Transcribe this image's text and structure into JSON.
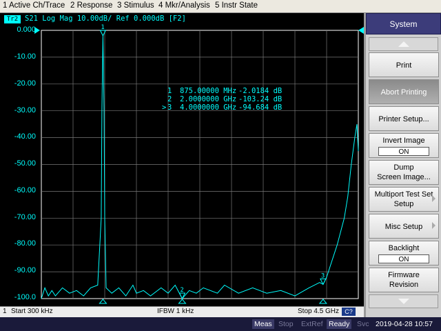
{
  "menu": [
    "1 Active Ch/Trace",
    "2 Response",
    "3 Stimulus",
    "4 Mkr/Analysis",
    "5 Instr State"
  ],
  "trace": {
    "badge": "Tr2",
    "info": "S21 Log Mag 10.00dB/ Ref 0.000dB [F2]",
    "color": "#00ffff"
  },
  "y_axis_labels": [
    "0.000",
    "-10.00",
    "-20.00",
    "-30.00",
    "-40.00",
    "-50.00",
    "-60.00",
    "-70.00",
    "-80.00",
    "-90.00",
    "-100.0"
  ],
  "markers": [
    {
      "label": "1",
      "prefix": "",
      "freq": "875.00000 MHz",
      "value": "-2.0184 dB"
    },
    {
      "label": "2",
      "prefix": "",
      "freq": "2.0000000 GHz",
      "value": "-103.24 dB"
    },
    {
      "label": "3",
      "prefix": ">",
      "freq": "4.0000000 GHz",
      "value": "-94.684 dB"
    }
  ],
  "footer": {
    "channel": "1",
    "start": "Start 300 kHz",
    "ifbw": "IFBW 1 kHz",
    "stop": "Stop 4.5 GHz",
    "cbadge": "C?"
  },
  "softkeys": {
    "title": "System",
    "items": [
      {
        "label": "Print"
      },
      {
        "label": "Abort Printing",
        "active": true
      },
      {
        "label": "Printer Setup..."
      },
      {
        "label": "Invert Image",
        "toggle": "ON"
      },
      {
        "label": "Dump",
        "label2": "Screen Image..."
      },
      {
        "label": "Multiport Test Set",
        "label2": "Setup",
        "chevron": true
      },
      {
        "label": "Misc Setup",
        "chevron": true
      },
      {
        "label": "Backlight",
        "toggle": "ON"
      },
      {
        "label": "Firmware",
        "label2": "Revision"
      }
    ]
  },
  "status": {
    "meas": "Meas",
    "stop": "Stop",
    "extref": "ExtRef",
    "ready": "Ready",
    "svc": "Svc",
    "datetime": "2019-04-28 10:57"
  },
  "chart_data": {
    "type": "line",
    "xlabel": "",
    "ylabel": "",
    "x_unit": "GHz",
    "xlim": [
      0.0003,
      4.5
    ],
    "ylim": [
      -100,
      0
    ],
    "grid": true,
    "series": [
      {
        "color": "#00ffff",
        "points": [
          [
            0.0003,
            -100
          ],
          [
            0.05,
            -96
          ],
          [
            0.1,
            -99
          ],
          [
            0.15,
            -97
          ],
          [
            0.2,
            -99
          ],
          [
            0.3,
            -96
          ],
          [
            0.4,
            -98
          ],
          [
            0.5,
            -97
          ],
          [
            0.6,
            -99
          ],
          [
            0.7,
            -96
          ],
          [
            0.8,
            -95
          ],
          [
            0.85,
            -70
          ],
          [
            0.86,
            -30
          ],
          [
            0.875,
            -2.02
          ],
          [
            0.89,
            -30
          ],
          [
            0.9,
            -70
          ],
          [
            0.92,
            -96
          ],
          [
            1.0,
            -98
          ],
          [
            1.1,
            -96
          ],
          [
            1.2,
            -99
          ],
          [
            1.3,
            -95
          ],
          [
            1.35,
            -98
          ],
          [
            1.45,
            -97
          ],
          [
            1.55,
            -99
          ],
          [
            1.7,
            -96
          ],
          [
            1.8,
            -98
          ],
          [
            1.9,
            -95
          ],
          [
            2.0,
            -103.24
          ],
          [
            2.1,
            -97
          ],
          [
            2.2,
            -98
          ],
          [
            2.3,
            -96
          ],
          [
            2.5,
            -98
          ],
          [
            2.6,
            -95
          ],
          [
            2.8,
            -98
          ],
          [
            3.0,
            -96
          ],
          [
            3.2,
            -98
          ],
          [
            3.4,
            -97
          ],
          [
            3.6,
            -99
          ],
          [
            3.8,
            -96
          ],
          [
            3.95,
            -94
          ],
          [
            4.0,
            -94.68
          ],
          [
            4.05,
            -92
          ],
          [
            4.1,
            -88
          ],
          [
            4.2,
            -80
          ],
          [
            4.3,
            -70
          ],
          [
            4.35,
            -62
          ],
          [
            4.4,
            -50
          ],
          [
            4.45,
            -40
          ],
          [
            4.48,
            -35
          ],
          [
            4.5,
            -45
          ]
        ]
      }
    ],
    "markers": [
      {
        "label": "1",
        "x": 0.875,
        "y": -2.0184
      },
      {
        "label": "2",
        "x": 2.0,
        "y": -103.24
      },
      {
        "label": "3",
        "x": 4.0,
        "y": -94.684
      }
    ]
  }
}
